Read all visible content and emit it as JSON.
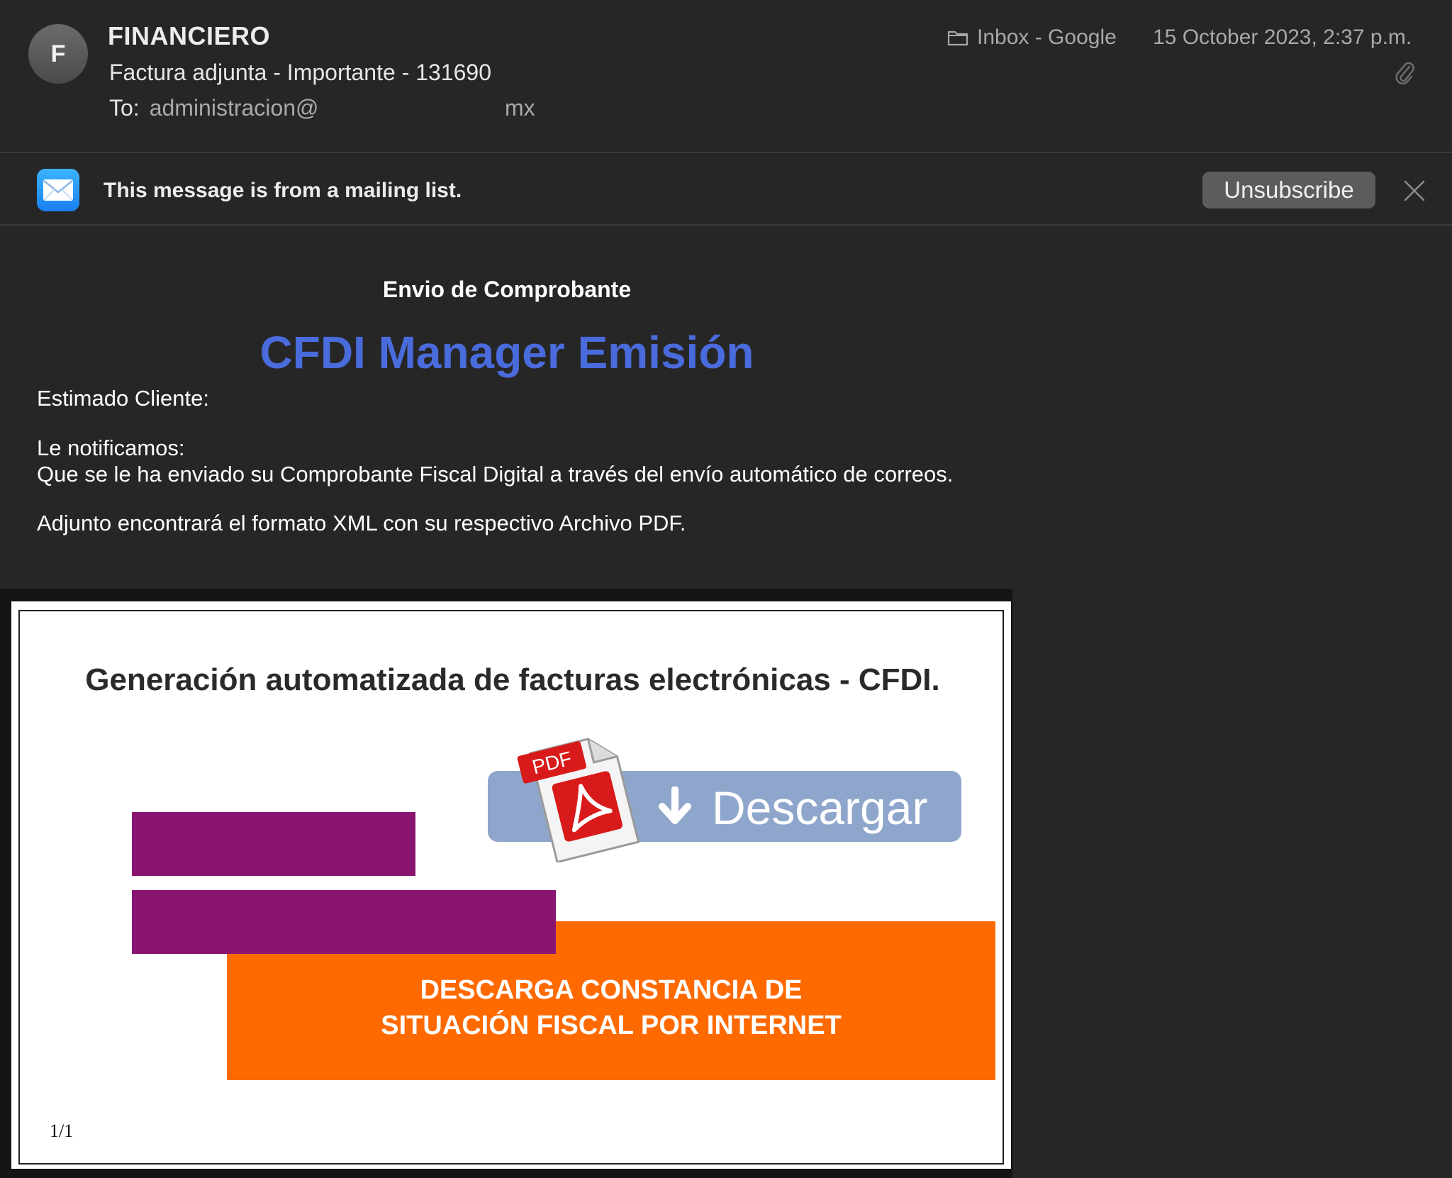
{
  "header": {
    "avatar_initial": "F",
    "sender": "FINANCIERO",
    "subject": "Factura adjunta - Importante - 131690",
    "to_label": "To:",
    "to_address": "administracion@",
    "to_domain": "mx",
    "mailbox": "Inbox - Google",
    "date": "15 October 2023, 2:37 p.m."
  },
  "banner": {
    "text": "This message is from a mailing list.",
    "unsubscribe_label": "Unsubscribe"
  },
  "body": {
    "heading": "Envio de Comprobante",
    "title": "CFDI Manager Emisión",
    "greeting": "Estimado Cliente:",
    "notice_line1": "Le notificamos:",
    "notice_line2": "Que se le ha enviado su Comprobante Fiscal Digital a través del envío automático de correos.",
    "attachment_note": "Adjunto encontrará el formato XML con su respectivo Archivo PDF."
  },
  "embedded_image": {
    "heading": "Generación automatizada de facturas electrónicas - CFDI.",
    "download_label": "Descargar",
    "pdf_badge": "PDF",
    "orange_line1": "DESCARGA CONSTANCIA DE",
    "orange_line2": "SITUACIÓN FISCAL POR INTERNET",
    "page_number": "1/1"
  },
  "colors": {
    "background": "#262626",
    "title_blue": "#4a6bdc",
    "purple_bar": "#8a1570",
    "orange_box": "#ff6a00",
    "download_button": "#8fa6cc"
  },
  "icons": {
    "folder": "folder-icon",
    "attachment": "paperclip-icon",
    "mail_app": "mail-envelope-icon",
    "close": "close-icon",
    "download": "download-arrow-icon",
    "pdf": "pdf-file-icon"
  }
}
